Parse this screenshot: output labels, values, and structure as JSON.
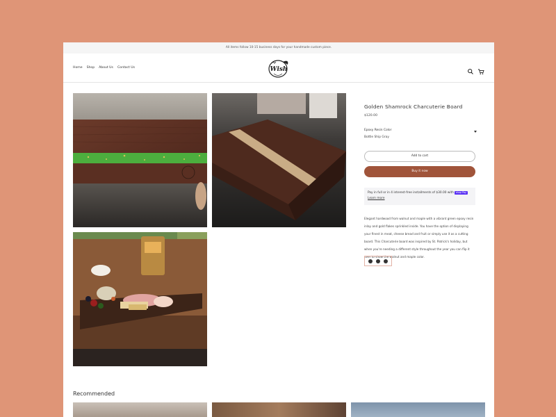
{
  "announcement": "All items follow 10-15 business days for your handmade custom piece.",
  "nav": {
    "items": [
      "Home",
      "Shop",
      "About Us",
      "Contact Us"
    ]
  },
  "header": {
    "logo_text": "Wish",
    "search_icon": "search-icon",
    "cart_icon": "cart-icon"
  },
  "product": {
    "title": "Golden Shamrock Charcuterie Board",
    "price": "$120.00",
    "option_label": "Epoxy Resin Color",
    "option_value": "Bottle Ship Gray",
    "add_to_cart": "Add to cart",
    "buy_now": "Buy it now",
    "payment_text": "Pay in full or in 4 interest-free installments of $30.00 with",
    "payment_brand": "shop Pay",
    "learn_more": "Learn more",
    "description": "Elegant hardwood from walnut and maple with a vibrant green epoxy resin inlay and gold flakes sprinkled inside. You have the option of displaying your finest in meat, cheese bread and fruit or simply use it as a cutting board. This Charcuterie board was inspired by St. Patrick's holiday, but when you're needing a different style throughout the year you can flip it over to show the walnut and maple color."
  },
  "share": [
    "pinterest-icon",
    "twitter-icon",
    "facebook-icon"
  ],
  "recommended_label": "Recommended",
  "colors": {
    "background": "#df9577",
    "accent": "#a0543a",
    "resin_green": "#4cae3e"
  }
}
